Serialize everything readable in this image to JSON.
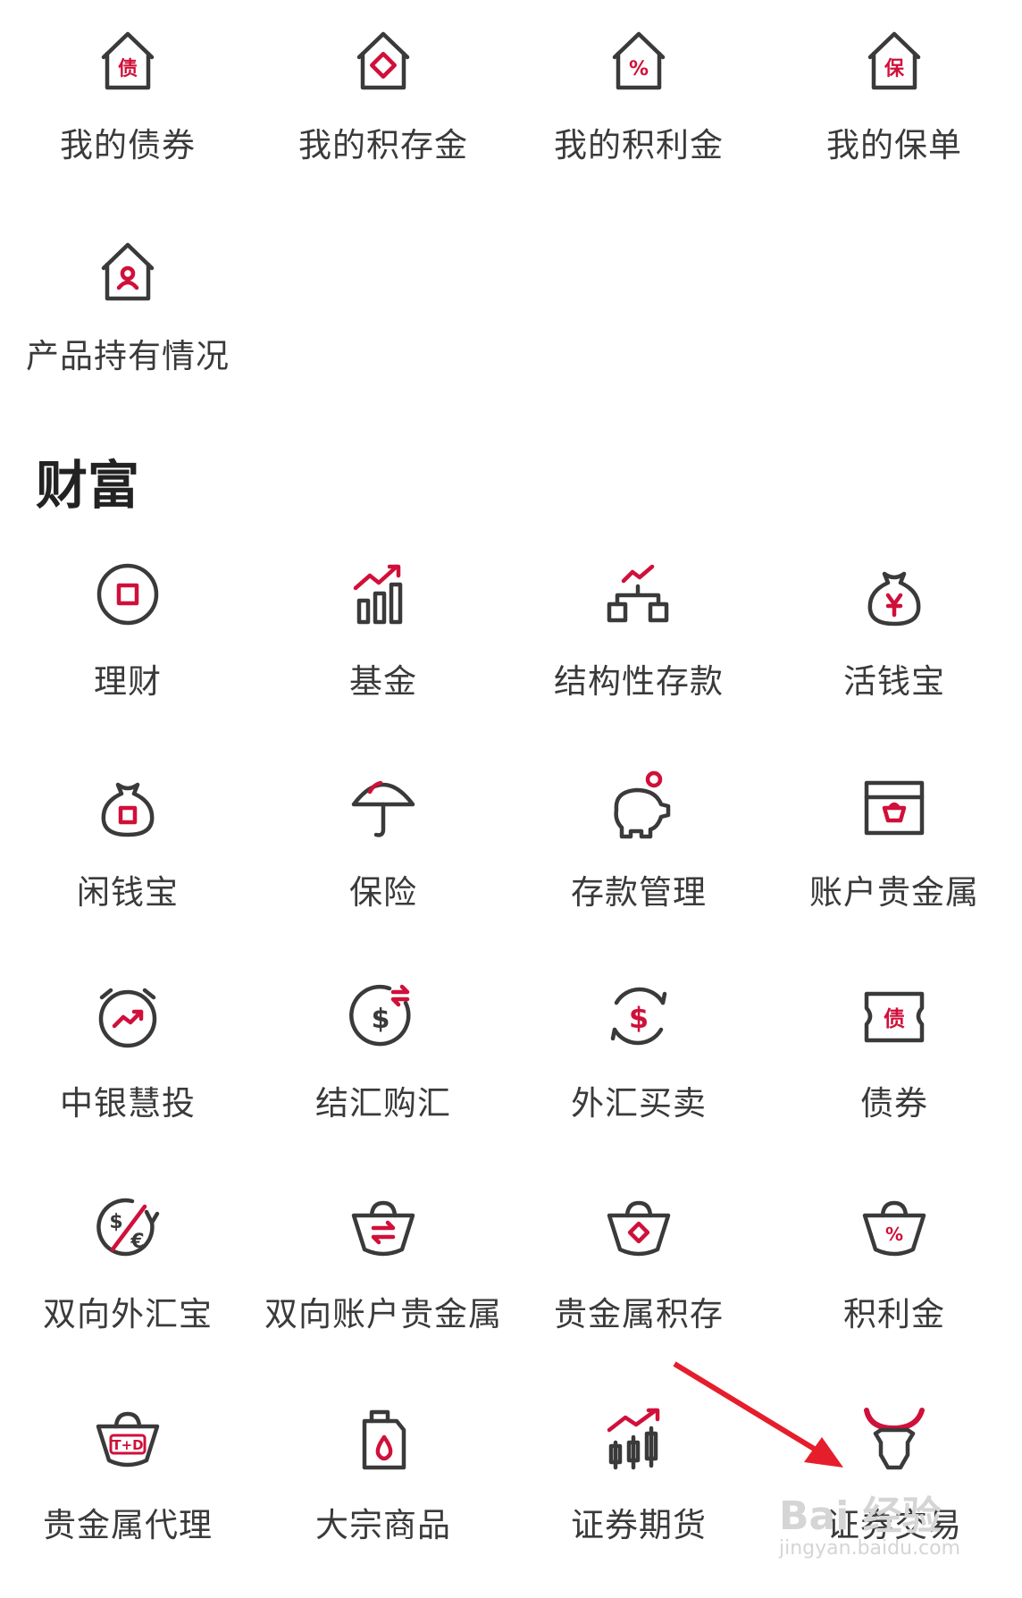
{
  "top_items": [
    {
      "label": "我的债券",
      "icon": "house-bond-icon",
      "glyph": "债"
    },
    {
      "label": "我的积存金",
      "icon": "house-diamond-icon",
      "glyph": ""
    },
    {
      "label": "我的积利金",
      "icon": "house-percent-icon",
      "glyph": "%"
    },
    {
      "label": "我的保单",
      "icon": "house-insurance-icon",
      "glyph": "保"
    },
    {
      "label": "产品持有情况",
      "icon": "house-person-icon",
      "glyph": ""
    }
  ],
  "section_title": "财富",
  "wealth_items": [
    {
      "label": "理财",
      "icon": "square-coin-icon"
    },
    {
      "label": "基金",
      "icon": "bar-trend-icon"
    },
    {
      "label": "结构性存款",
      "icon": "structure-trend-icon"
    },
    {
      "label": "活钱宝",
      "icon": "yen-bag-icon"
    },
    {
      "label": "闲钱宝",
      "icon": "square-bag-icon"
    },
    {
      "label": "保险",
      "icon": "umbrella-icon"
    },
    {
      "label": "存款管理",
      "icon": "piggy-bank-icon"
    },
    {
      "label": "账户贵金属",
      "icon": "gold-box-icon"
    },
    {
      "label": "中银慧投",
      "icon": "clock-trend-icon"
    },
    {
      "label": "结汇购汇",
      "icon": "dollar-exchange-icon"
    },
    {
      "label": "外汇买卖",
      "icon": "dollar-cycle-icon"
    },
    {
      "label": "债券",
      "icon": "bond-ticket-icon",
      "glyph": "债"
    },
    {
      "label": "双向外汇宝",
      "icon": "dollar-euro-icon"
    },
    {
      "label": "双向账户贵金属",
      "icon": "ingot-exchange-icon"
    },
    {
      "label": "贵金属积存",
      "icon": "ingot-diamond-icon"
    },
    {
      "label": "积利金",
      "icon": "ingot-percent-icon",
      "glyph": "%"
    },
    {
      "label": "贵金属代理",
      "icon": "ingot-td-icon",
      "glyph": "T+D"
    },
    {
      "label": "大宗商品",
      "icon": "oil-can-icon"
    },
    {
      "label": "证券期货",
      "icon": "candlestick-icon"
    },
    {
      "label": "证券交易",
      "icon": "bull-icon"
    }
  ],
  "watermark": {
    "logo": "Bai 经验",
    "url": "jingyan.baidu.com"
  },
  "colors": {
    "accent": "#d0103a",
    "stroke": "#3a3a3a",
    "text": "#3a3a3a",
    "background": "#ffffff"
  }
}
